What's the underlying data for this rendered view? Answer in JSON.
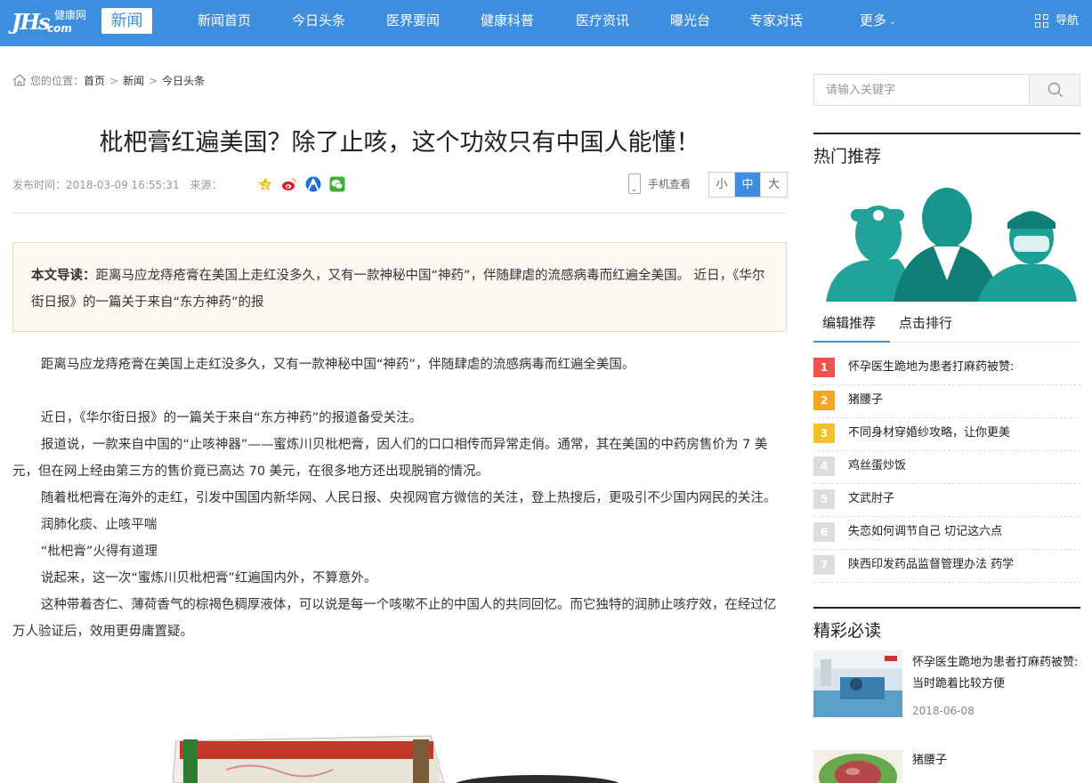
{
  "logo": {
    "main": "JHs",
    "top": "健康网",
    "bottom": "com",
    "badge": "新闻"
  },
  "nav": {
    "items": [
      "新闻首页",
      "今日头条",
      "医界要闻",
      "健康科普",
      "医疗资讯",
      "曝光台",
      "专家对话"
    ],
    "more": "更多",
    "guide": "导航"
  },
  "breadcrumb": {
    "prefix": "您的位置：",
    "home": "首页",
    "section": "新闻",
    "current": "今日头条",
    "sep": ">"
  },
  "article": {
    "title": "枇杷膏红遍美国？除了止咳，这个功效只有中国人能懂！",
    "publish_label": "发布时间：2018-03-09 16:55:31",
    "source_label": "来源：",
    "mobile_view": "手机查看",
    "font_sizes": [
      "小",
      "中",
      "大"
    ],
    "lead_label": "本文导读：",
    "lead_text": "距离马应龙痔疮膏在美国上走红没多久，又有一款神秘中国“神药”，伴随肆虐的流感病毒而红遍全美国。 近日，《华尔街日报》的一篇关于来自“东方神药”的报",
    "paragraphs": [
      "距离马应龙痔疮膏在美国上走红没多久，又有一款神秘中国“神药”，伴随肆虐的流感病毒而红遍全美国。",
      "",
      "近日，《华尔街日报》的一篇关于来自“东方神药”的报道备受关注。",
      "报道说，一款来自中国的“止咳神器”——蜜炼川贝枇杷膏，因人们的口口相传而异常走俏。通常，其在美国的中药房售价为 7 美元，但在网上经由第三方的售价竟已高达 70 美元，在很多地方还出现脱销的情况。",
      "随着枇杷膏在海外的走红，引发中国国内新华网、人民日报、央视网官方微信的关注，登上热搜后，更吸引不少国内网民的关注。",
      "润肺化痰、止咳平喘",
      "“枇杷膏”火得有道理",
      "说起来，这一次“蜜炼川贝枇杷膏”红遍国内外，不算意外。",
      "这种带着杏仁、薄荷香气的棕褐色稠厚液体，可以说是每一个咳嗽不止的中国人的共同回忆。而它独特的润肺止咳疗效，在经过亿万人验证后，效用更毋庸置疑。"
    ]
  },
  "sidebar": {
    "search_placeholder": "请输入关键字",
    "hot_heading": "热门推荐",
    "tabs": [
      "编辑推荐",
      "点击排行"
    ],
    "rank": [
      {
        "num": "1",
        "title": "怀孕医生跪地为患者打麻药被赞:",
        "color": "#f0524d"
      },
      {
        "num": "2",
        "title": "猪腰子",
        "color": "#f5a623"
      },
      {
        "num": "3",
        "title": "不同身材穿婚纱攻略，让你更美",
        "color": "#f5c12a"
      },
      {
        "num": "4",
        "title": "鸡丝蛋炒饭",
        "color": "#dddddd"
      },
      {
        "num": "5",
        "title": "文武肘子",
        "color": "#dddddd"
      },
      {
        "num": "6",
        "title": "失恋如何调节自己 切记这六点",
        "color": "#dddddd"
      },
      {
        "num": "7",
        "title": "陕西印发药品监督管理办法 药学",
        "color": "#dddddd"
      }
    ],
    "must_read_heading": "精彩必读",
    "must_read": [
      {
        "title": "怀孕医生跪地为患者打麻药被赞:当时跪着比较方便",
        "date": "2018-06-08"
      },
      {
        "title": "猪腰子",
        "date": ""
      }
    ]
  },
  "colors": {
    "brand": "#3e8ee0",
    "lead_bg": "#fef9f2",
    "lead_border": "#f6d7b7"
  }
}
